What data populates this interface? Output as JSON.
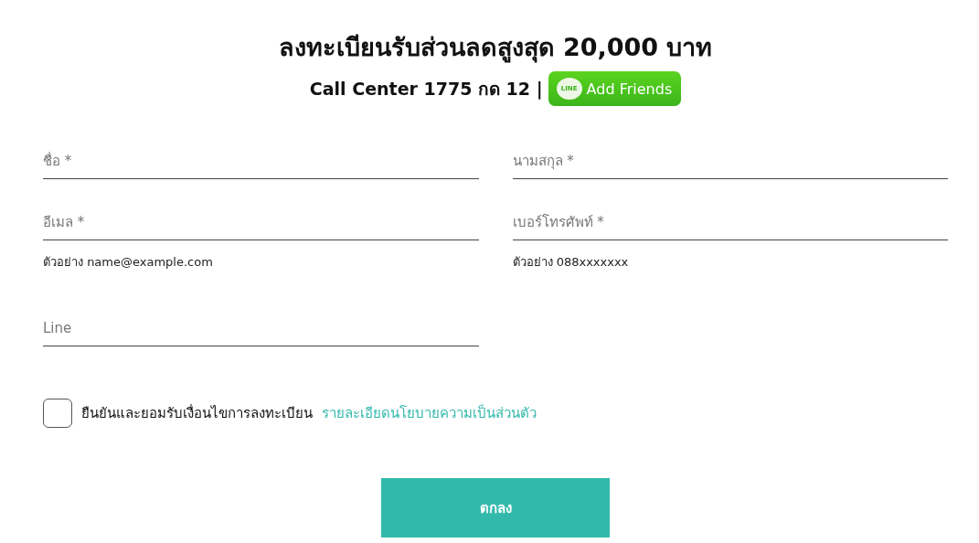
{
  "title": "ลงทะเบียนรับส่วนลดสูงสุด 20,000 บาท",
  "call_center": "Call Center 1775 กด 12 |",
  "line_button": {
    "badge": "LINE",
    "label": "Add Friends"
  },
  "fields": [
    {
      "placeholder": "ชื่อ *"
    },
    {
      "placeholder": "นามสกุล *"
    },
    {
      "placeholder": "อีเมล *",
      "hint": "ตัวอย่าง name@example.com"
    },
    {
      "placeholder": "เบอร์โทรศัพท์ *",
      "hint": "ตัวอย่าง 088xxxxxxx"
    },
    {
      "placeholder": "Line"
    }
  ],
  "consent": {
    "checked": false,
    "label": "ยืนยันและยอมรับเงื่อนไขการลงทะเบียน",
    "link": "รายละเอียดนโยบายความเป็นส่วนตัว"
  },
  "submit": "ตกลง"
}
